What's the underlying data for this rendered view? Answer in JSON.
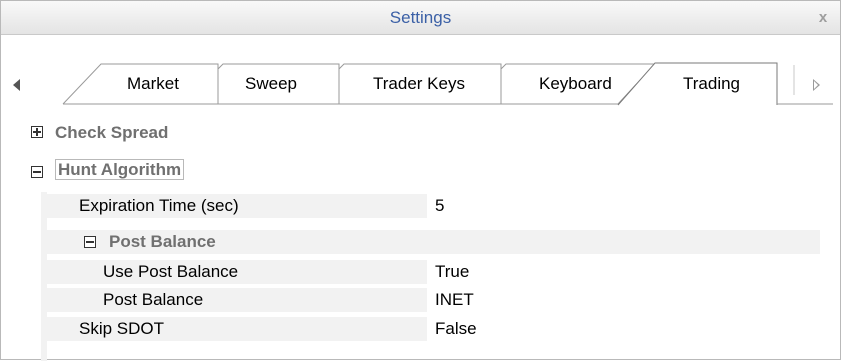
{
  "window": {
    "title": "Settings",
    "close_glyph": "x"
  },
  "tabs": {
    "items": [
      {
        "label": "Market"
      },
      {
        "label": "Sweep"
      },
      {
        "label": "Trader Keys"
      },
      {
        "label": "Keyboard"
      },
      {
        "label": "Trading",
        "selected": true
      }
    ],
    "scroll_left_icon": "left-arrow-icon",
    "scroll_right_icon": "right-arrow-icon"
  },
  "grid": {
    "check_spread": {
      "label": "Check Spread",
      "expanded": false
    },
    "hunt_algorithm": {
      "label": "Hunt Algorithm",
      "expanded": true,
      "expiration_time": {
        "name": "Expiration Time (sec)",
        "value": "5"
      },
      "post_balance_group": {
        "label": "Post Balance",
        "expanded": true,
        "use_post_balance": {
          "name": "Use Post Balance",
          "value": "True"
        },
        "post_balance": {
          "name": "Post Balance",
          "value": "INET"
        }
      },
      "skip_sdot": {
        "name": "Skip SDOT",
        "value": "False"
      }
    }
  },
  "colors": {
    "title_text": "#3b60a6",
    "category_text": "#707070",
    "property_bg": "#f2f2f2"
  }
}
